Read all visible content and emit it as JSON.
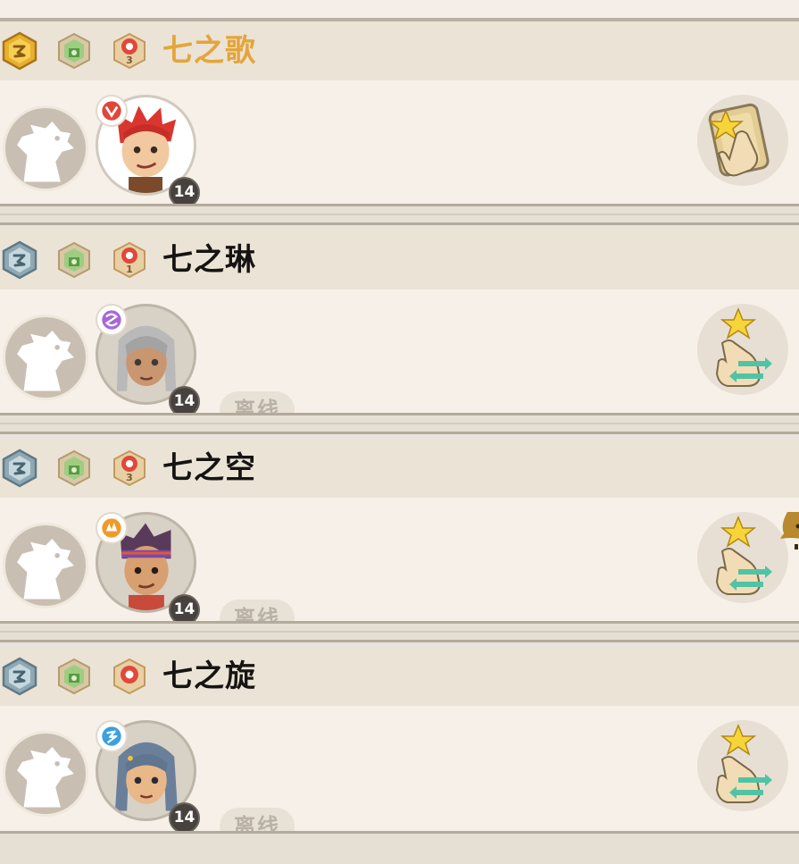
{
  "players": [
    {
      "name": "七之歌",
      "name_color": "gold",
      "rank_badge": "gold-rank-badge",
      "troop_badge": "troop-badge",
      "medal_badge": "medal-badge-3",
      "pet_slot": "empty-pet-silhouette",
      "avatar": "red-hair-boy-avatar",
      "element": "red-element-icon",
      "level": "14",
      "status": "",
      "action": "card-tap-icon"
    },
    {
      "name": "七之琳",
      "name_color": "dark",
      "rank_badge": "silver-rank-badge",
      "troop_badge": "troop-badge",
      "medal_badge": "medal-badge-1",
      "pet_slot": "empty-pet-silhouette",
      "avatar": "silver-hair-girl-avatar",
      "element": "purple-element-icon",
      "level": "14",
      "status": "离线",
      "action": "tap-swap-icon"
    },
    {
      "name": "七之空",
      "name_color": "dark",
      "rank_badge": "silver-rank-badge",
      "troop_badge": "troop-badge",
      "medal_badge": "medal-badge-3",
      "pet_slot": "empty-pet-silhouette",
      "avatar": "headband-boy-avatar",
      "element": "orange-element-icon",
      "level": "14",
      "status": "离线",
      "action": "tap-swap-icon"
    },
    {
      "name": "七之旋",
      "name_color": "dark",
      "rank_badge": "silver-rank-badge",
      "troop_badge": "troop-badge",
      "medal_badge": "medal-badge",
      "pet_slot": "empty-pet-silhouette",
      "avatar": "blue-hair-girl-avatar",
      "element": "blue-element-icon",
      "level": "14",
      "status": "离线",
      "action": "tap-swap-icon"
    }
  ],
  "medal_numbers": [
    "3",
    "1",
    "3",
    ""
  ],
  "colors": {
    "header_bg": "#ebe3d6",
    "body_bg": "#f6f0e8",
    "name_gold": "#e4a53a",
    "name_dark": "#161412",
    "level_badge": "#47423d",
    "status_text": "#b9b1a6"
  }
}
